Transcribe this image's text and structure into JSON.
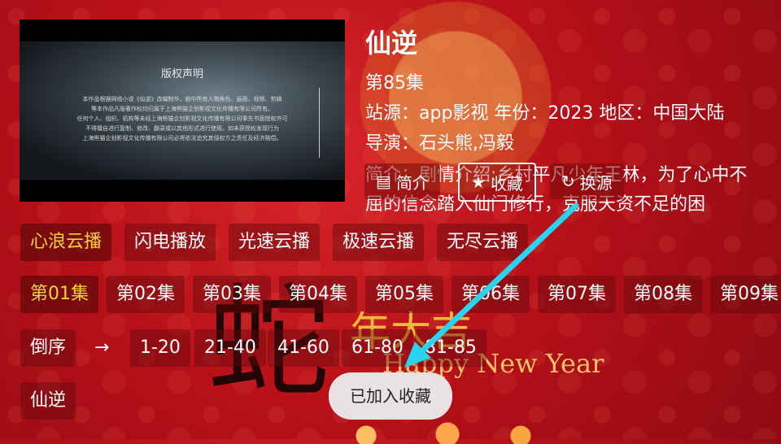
{
  "detail": {
    "title": "仙逆",
    "episode": "第85集",
    "meta": "站源：app影视  年份：2023  地区：中国大陆",
    "director": "导演：石头熊,冯毅",
    "intro": "简介：剧情介绍:乡村平凡少年王林，为了心中不屈的信念踏入仙门修行，克服天资不足的困"
  },
  "poster": {
    "heading": "版权声明",
    "lines": [
      "本作品根据网络小说《仙逆》改编制作，剧中所有人物角色、画面、视频、剪辑",
      "等本作品凡版著作权均归属于上海熊猫企划影视文化传播有限公司所有。",
      "任何个人、组织、机构等未经上海熊猫企划影视文化传播有限公司事先书面授权许可",
      "不得擅自进行复制、修改、翻录或以其他形式进行使用。如未获授权发现行为",
      "上海熊猫企划影视文化传播有限公司必将依法追究其侵权方之责任及经济赔偿。"
    ]
  },
  "actions": {
    "intro_label": "简介",
    "favorite_label": "收藏",
    "switch_label": "换源"
  },
  "sources": [
    "心浪云播",
    "闪电播放",
    "光速云播",
    "极速云播",
    "无尽云播"
  ],
  "episodes": [
    "第01集",
    "第02集",
    "第03集",
    "第04集",
    "第05集",
    "第06集",
    "第07集",
    "第08集",
    "第09集"
  ],
  "ranges": {
    "order_label": "倒序",
    "arrow": "→",
    "items": [
      "1-20",
      "21-40",
      "41-60",
      "61-80",
      "81-85"
    ]
  },
  "related": [
    "仙逆"
  ],
  "background": {
    "calligraphy": "蛇",
    "nian": "年大吉",
    "happy": "Happy New Year"
  },
  "toast": "已加入收藏",
  "colors": {
    "active": "#f7d23c",
    "arrow": "#2ad3f0"
  }
}
